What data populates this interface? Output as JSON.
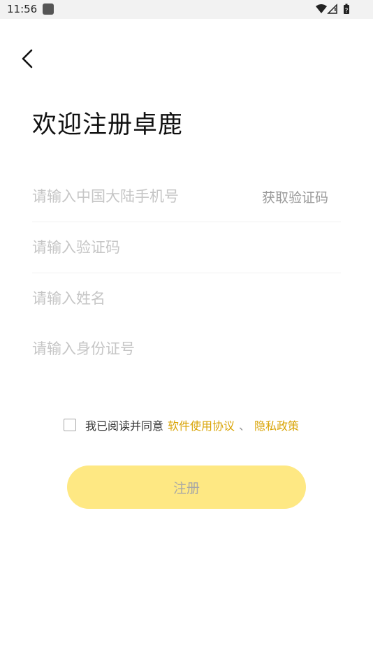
{
  "status_bar": {
    "time": "11:56",
    "icons": [
      "app-notification-icon",
      "wifi-icon",
      "signal-icon",
      "battery-icon"
    ]
  },
  "header": {
    "back_icon": "chevron-left-icon",
    "title": "欢迎注册卓鹿"
  },
  "form": {
    "phone": {
      "placeholder": "请输入中国大陆手机号",
      "value": ""
    },
    "get_code_label": "获取验证码",
    "code": {
      "placeholder": "请输入验证码",
      "value": ""
    },
    "name": {
      "placeholder": "请输入姓名",
      "value": ""
    },
    "id_number": {
      "placeholder": "请输入身份证号",
      "value": ""
    }
  },
  "agreement": {
    "checked": false,
    "prefix": "我已阅读并同意",
    "terms_link": "软件使用协议",
    "separator": "、",
    "privacy_link": "隐私政策"
  },
  "register": {
    "label": "注册"
  },
  "colors": {
    "accent_link": "#d9a406",
    "button_bg": "#fee883",
    "button_text": "#a7a7a7",
    "placeholder": "#c6c6c6"
  }
}
